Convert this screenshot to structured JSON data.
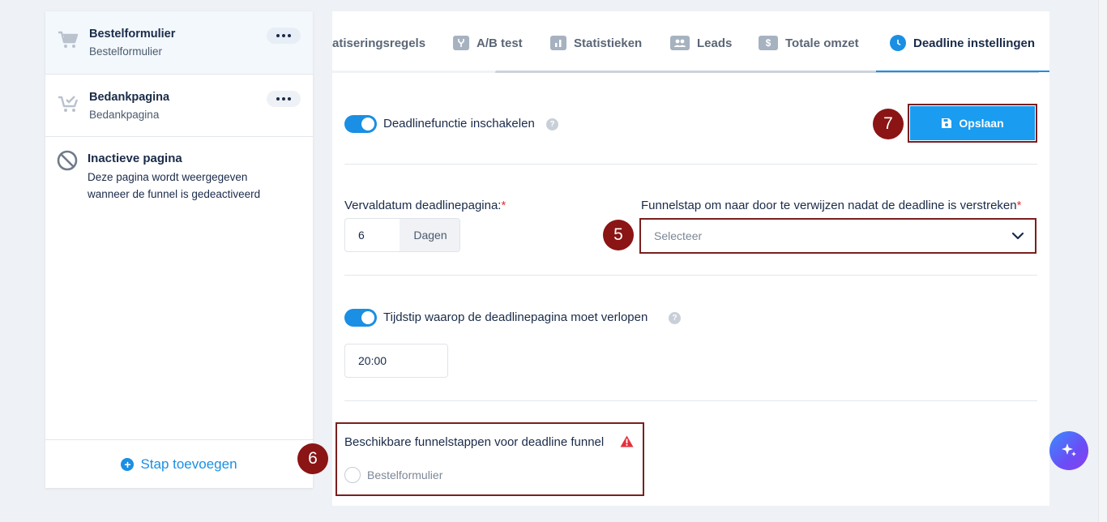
{
  "sidebar": {
    "steps": [
      {
        "title": "Bestelformulier",
        "subtitle": "Bestelformulier",
        "icon": "cart-icon"
      },
      {
        "title": "Bedankpagina",
        "subtitle": "Bedankpagina",
        "icon": "cart-check-icon"
      }
    ],
    "inactive": {
      "title": "Inactieve pagina",
      "description": "Deze pagina wordt weergegeven wanneer de funnel is gedeactiveerd"
    },
    "add_step_label": "Stap toevoegen"
  },
  "tabs": [
    {
      "label": "atiseringsregels",
      "icon": ""
    },
    {
      "label": "A/B test",
      "icon": "split-icon"
    },
    {
      "label": "Statistieken",
      "icon": "bar-chart-icon"
    },
    {
      "label": "Leads",
      "icon": "users-icon"
    },
    {
      "label": "Totale omzet",
      "icon": "dollar-icon"
    },
    {
      "label": "Deadline instellingen",
      "icon": "clock-icon",
      "active": true
    }
  ],
  "deadline": {
    "enable_label": "Deadlinefunctie inschakelen",
    "enable_on": true,
    "save_label": "Opslaan",
    "expiry_label": "Vervaldatum deadlinepagina:",
    "expiry_value": "6",
    "expiry_unit": "Dagen",
    "redirect_label": "Funnelstap om naar door te verwijzen nadat de deadline is verstreken",
    "redirect_placeholder": "Selecteer",
    "required_mark": "*",
    "time_toggle_label": "Tijdstip waarop de deadlinepagina moet verlopen",
    "time_toggle_on": true,
    "time_value": "20:00",
    "available_label": "Beschikbare funnelstappen voor deadline funnel",
    "available_options": [
      "Bestelformulier"
    ],
    "help_glyph": "?"
  },
  "annotations": {
    "badge_save": "7",
    "badge_select": "5",
    "badge_available": "6"
  },
  "colors": {
    "accent": "#1a8fe3",
    "annotation": "#8b1414",
    "warning": "#e5303b"
  }
}
